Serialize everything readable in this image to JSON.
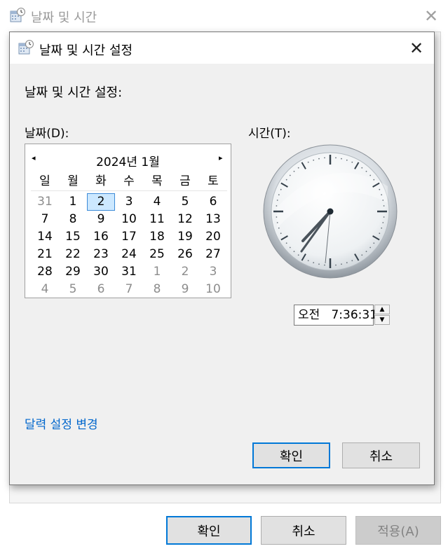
{
  "parent_window": {
    "title": "날짜 및 시간",
    "buttons": {
      "ok": "확인",
      "cancel": "취소",
      "apply": "적용(A)"
    }
  },
  "dialog": {
    "title": "날짜 및 시간 설정",
    "heading": "날짜 및 시간 설정:",
    "date_label": "날짜(D):",
    "time_label": "시간(T):",
    "calendar": {
      "month_label": "2024년 1월",
      "prev_glyph": "◂",
      "next_glyph": "▸",
      "weekdays": [
        "일",
        "월",
        "화",
        "수",
        "목",
        "금",
        "토"
      ],
      "weeks": [
        [
          "31",
          "1",
          "2",
          "3",
          "4",
          "5",
          "6"
        ],
        [
          "7",
          "8",
          "9",
          "10",
          "11",
          "12",
          "13"
        ],
        [
          "14",
          "15",
          "16",
          "17",
          "18",
          "19",
          "20"
        ],
        [
          "21",
          "22",
          "23",
          "24",
          "25",
          "26",
          "27"
        ],
        [
          "28",
          "29",
          "30",
          "31",
          "1",
          "2",
          "3"
        ],
        [
          "4",
          "5",
          "6",
          "7",
          "8",
          "9",
          "10"
        ]
      ],
      "selected": "2"
    },
    "time": {
      "value": "오전   7:36:31",
      "spin_up": "▲",
      "spin_down": "▼"
    },
    "calendar_link": "달력 설정 변경",
    "buttons": {
      "ok": "확인",
      "cancel": "취소"
    }
  },
  "icons": {
    "title_icon": "calendar-clock-icon",
    "close": "close-icon"
  },
  "colors": {
    "accent": "#0078d7",
    "selection": "#cce8ff",
    "link": "#0066cc"
  }
}
